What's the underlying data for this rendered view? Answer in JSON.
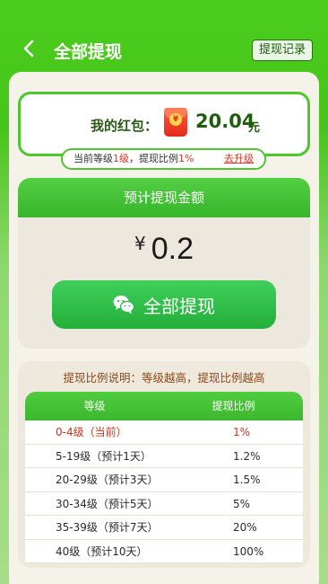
{
  "header": {
    "title": "全部提现",
    "record_label": "提现记录"
  },
  "wallet": {
    "label": "我的红包：",
    "amount": "20.04",
    "unit": "元",
    "level_prefix": "当前等级",
    "level_value": "1级",
    "ratio_prefix": "，提现比例",
    "ratio_value": "1%",
    "upgrade_label": "去升级"
  },
  "estimate": {
    "heading": "预计提现金额",
    "currency": "¥",
    "value": "0.2",
    "button_label": "全部提现"
  },
  "ratio": {
    "title": "提现比例说明：等级越高，提现比例越高",
    "col_level": "等级",
    "col_ratio": "提现比例",
    "rows": [
      {
        "level": "0-4级（当前）",
        "ratio": "1%"
      },
      {
        "level": "5-19级（预计1天）",
        "ratio": "1.2%"
      },
      {
        "level": "20-29级（预计3天）",
        "ratio": "1.5%"
      },
      {
        "level": "30-34级（预计5天）",
        "ratio": "5%"
      },
      {
        "level": "35-39级（预计7天）",
        "ratio": "20%"
      },
      {
        "level": "40级（预计10天）",
        "ratio": "100%"
      }
    ]
  },
  "colors": {
    "brand_green": "#4ccd1e",
    "accent_red": "#e0301e"
  },
  "icons": [
    "chevron-left-icon",
    "red-packet-icon",
    "wechat-icon"
  ]
}
